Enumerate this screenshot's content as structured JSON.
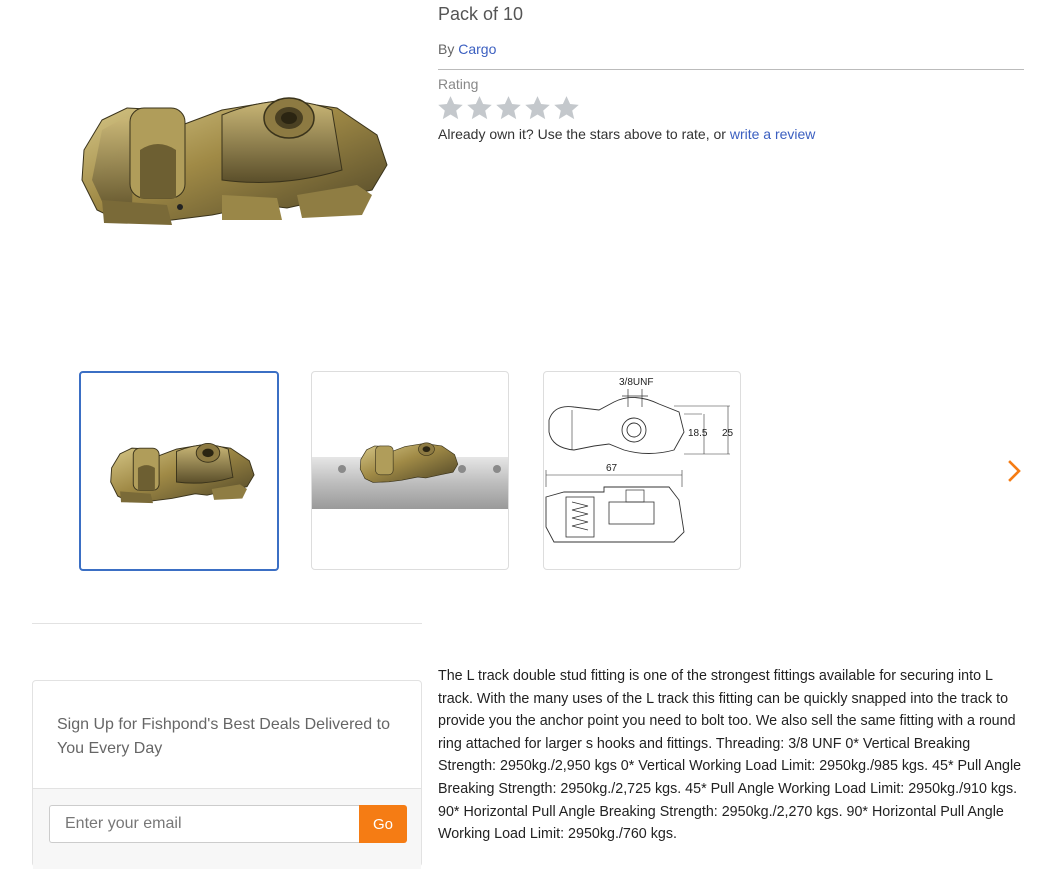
{
  "product": {
    "title": "Pack of 10",
    "by_prefix": "By",
    "brand": "Cargo",
    "rating_label": "Rating",
    "rating": 0,
    "max_rating": 5,
    "star_color_empty": "#c4c8cc",
    "rate_prompt": "Already own it? Use the stars above to rate, or",
    "write_review_link": "write a review",
    "description": "The L track double stud fitting is one of the strongest fittings available for securing into L track. With the many uses of the L track this fitting can be quickly snapped into the track to provide you the anchor point you need to bolt too. We also sell the same fitting with a round ring attached for larger s hooks and fittings. Threading: 3/8 UNF 0* Vertical Breaking Strength: 2950kg./2,950 kgs 0* Vertical Working Load Limit: 2950kg./985 kgs. 45* Pull Angle Breaking Strength: 2950kg./2,725 kgs. 45* Pull Angle Working Load Limit: 2950kg./910 kgs. 90* Horizontal Pull Angle Breaking Strength: 2950kg./2,270 kgs. 90* Horizontal Pull Angle Working Load Limit: 2950kg./760 kgs."
  },
  "gallery": {
    "selected_index": 0,
    "next_icon": "chevron-right-icon",
    "accent_color": "#f57c14",
    "diagram_labels": {
      "thread": "3/8UNF",
      "inner_height": "18.5",
      "outer_height": "25",
      "length": "67"
    }
  },
  "signup": {
    "heading": "Sign Up for Fishpond's Best Deals Delivered to You Every Day",
    "email_placeholder": "Enter your email",
    "go_label": "Go",
    "button_color": "#f57c14"
  }
}
